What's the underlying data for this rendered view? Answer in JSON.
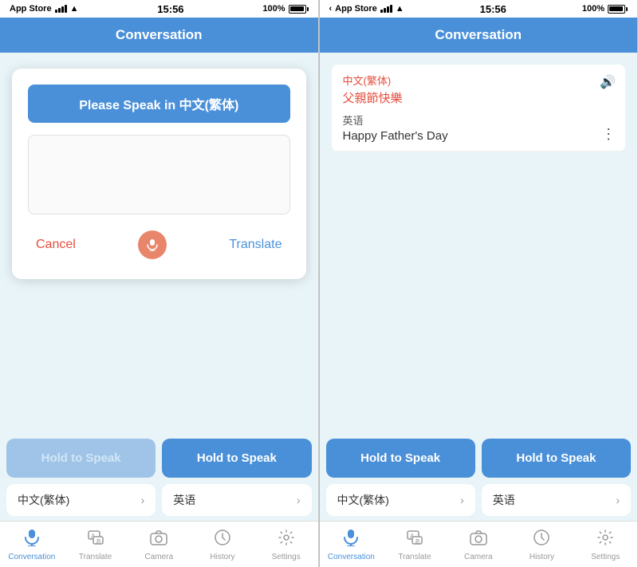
{
  "panel1": {
    "statusBar": {
      "appStore": "App Store",
      "signal": "●●●",
      "wifi": "wifi",
      "time": "15:56",
      "batteryPct": "100%"
    },
    "header": {
      "title": "Conversation"
    },
    "modal": {
      "title": "Please Speak in 中文(繁体)",
      "cancelLabel": "Cancel",
      "translateLabel": "Translate"
    },
    "holdBtns": [
      {
        "label": "Hold to Speak",
        "disabled": true
      },
      {
        "label": "Hold to Speak",
        "disabled": false
      }
    ],
    "langSelects": [
      {
        "lang": "中文(繁体)"
      },
      {
        "lang": "英语"
      }
    ]
  },
  "panel2": {
    "statusBar": {
      "appStore": "App Store",
      "signal": "●●●",
      "wifi": "wifi",
      "time": "15:56",
      "batteryPct": "100%"
    },
    "header": {
      "title": "Conversation"
    },
    "conversation": {
      "item1": {
        "lang": "中文(繁体)",
        "text": "父親節快樂"
      },
      "item2": {
        "lang": "英语",
        "text": "Happy Father's Day"
      }
    },
    "holdBtns": [
      {
        "label": "Hold to Speak",
        "disabled": false
      },
      {
        "label": "Hold to Speak",
        "disabled": false
      }
    ],
    "langSelects": [
      {
        "lang": "中文(繁体)"
      },
      {
        "lang": "英语"
      }
    ]
  },
  "tabBar": {
    "tabs": [
      {
        "id": "conversation",
        "label": "Conversation",
        "icon": "🎤"
      },
      {
        "id": "translate",
        "label": "Translate",
        "icon": "A"
      },
      {
        "id": "camera",
        "label": "Camera",
        "icon": "📷"
      },
      {
        "id": "history",
        "label": "History",
        "icon": "🕐"
      },
      {
        "id": "settings",
        "label": "Settings",
        "icon": "⚙️"
      }
    ]
  }
}
